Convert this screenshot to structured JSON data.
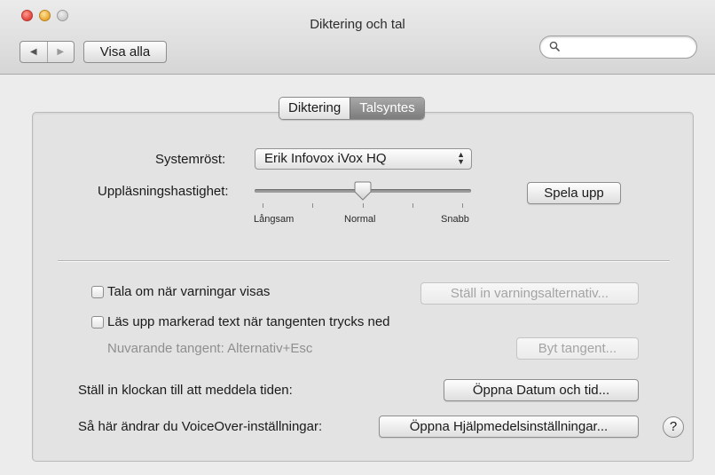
{
  "window": {
    "title": "Diktering och tal"
  },
  "toolbar": {
    "back_glyph": "◀",
    "forward_glyph": "▶",
    "show_all_label": "Visa alla",
    "search_placeholder": ""
  },
  "tabs": [
    {
      "label": "Diktering",
      "selected": false
    },
    {
      "label": "Talsyntes",
      "selected": true
    }
  ],
  "voice": {
    "label": "Systemröst:",
    "selected": "Erik Infovox iVox HQ"
  },
  "rate": {
    "label": "Uppläsningshastighet:",
    "min_label": "Långsam",
    "mid_label": "Normal",
    "max_label": "Snabb",
    "value_fraction": 0.5,
    "play_label": "Spela upp"
  },
  "alerts": {
    "checkbox_label": "Tala om när varningar visas",
    "checked": false,
    "options_button": "Ställ in varningsalternativ..."
  },
  "speak_selection": {
    "checkbox_label": "Läs upp markerad text när tangenten trycks ned",
    "checked": false,
    "current_key_text": "Nuvarande tangent: Alternativ+Esc",
    "change_key_button": "Byt tangent..."
  },
  "clock": {
    "label": "Ställ in klockan till att meddela tiden:",
    "button": "Öppna Datum och tid..."
  },
  "voiceover": {
    "label": "Så här ändrar du VoiceOver-inställningar:",
    "button": "Öppna Hjälpmedelsinställningar..."
  },
  "help": {
    "label": "?"
  },
  "colors": {
    "window_bg": "#ececec",
    "group_bg": "#e3e3e3",
    "selected_tab": "#8f8f8f",
    "close": "#e0443a",
    "minimize": "#e8a72f"
  }
}
